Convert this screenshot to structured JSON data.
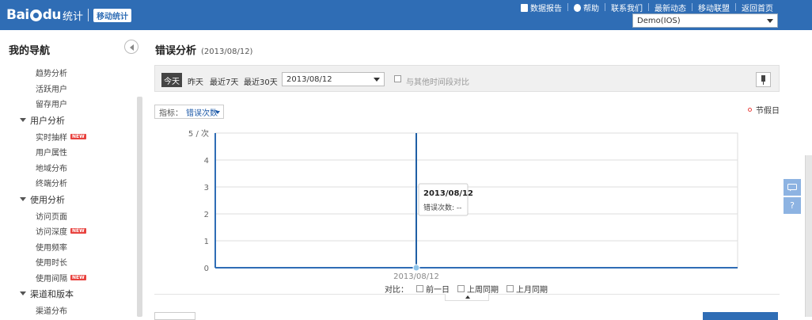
{
  "header": {
    "logo_text": "Bai",
    "logo_du": "du",
    "logo_tongji": "统计",
    "logo_badge": "移动统计",
    "links": [
      "数据报告",
      "帮助",
      "联系我们",
      "最新动态",
      "移动联盟",
      "返回首页"
    ],
    "app_selected": "Demo(IOS)"
  },
  "sidebar": {
    "title": "我的导航",
    "items": [
      {
        "type": "item",
        "label": "趋势分析"
      },
      {
        "type": "item",
        "label": "活跃用户"
      },
      {
        "type": "item",
        "label": "留存用户"
      },
      {
        "type": "group",
        "label": "用户分析"
      },
      {
        "type": "item",
        "label": "实时抽样",
        "new": true
      },
      {
        "type": "item",
        "label": "用户属性"
      },
      {
        "type": "item",
        "label": "地域分布"
      },
      {
        "type": "item",
        "label": "终端分析"
      },
      {
        "type": "group",
        "label": "使用分析"
      },
      {
        "type": "item",
        "label": "访问页面"
      },
      {
        "type": "item",
        "label": "访问深度",
        "new": true
      },
      {
        "type": "item",
        "label": "使用频率"
      },
      {
        "type": "item",
        "label": "使用时长"
      },
      {
        "type": "item",
        "label": "使用间隔",
        "new": true
      },
      {
        "type": "group",
        "label": "渠道和版本"
      },
      {
        "type": "item",
        "label": "渠道分布"
      }
    ],
    "new_badge": "NEW"
  },
  "main": {
    "title": "错误分析",
    "title_date": "(2013/08/12)",
    "filters": {
      "today": "今天",
      "yesterday": "昨天",
      "last7": "最近7天",
      "last30": "最近30天",
      "date_value": "2013/08/12",
      "compare_label": "与其他时间段对比"
    },
    "metric_label": "指标：",
    "metric_value": "错误次数",
    "holiday_label": "节假日",
    "legend_prefix": "对比：",
    "legend_items": [
      "前一日",
      "上周同期",
      "上月同期"
    ]
  },
  "chart_data": {
    "type": "line",
    "x": [
      "2013/08/12"
    ],
    "series": [
      {
        "values": [
          0
        ]
      }
    ],
    "ylim": [
      0,
      5
    ],
    "yticks": [
      "0",
      "1",
      "2",
      "3",
      "4",
      "5 / 次"
    ],
    "xticks": [
      "2013/08/12"
    ],
    "tooltip": {
      "title": "2013/08/12",
      "label": "错误次数: --"
    },
    "grid": true,
    "colors": {
      "line": "#1f5fa5",
      "grid": "#dcdcdc",
      "axis": "#2f6db5"
    }
  },
  "float_tools": [
    "comment-icon",
    "help-icon"
  ],
  "colors": {
    "brand": "#2f6db5",
    "new_badge": "#e8423e"
  }
}
